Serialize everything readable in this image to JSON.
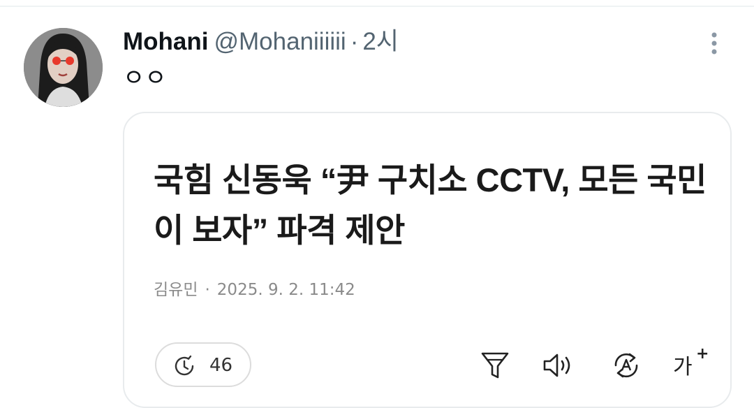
{
  "tweet": {
    "display_name": "Mohani",
    "handle": "@Mohaniiiiii",
    "separator": "·",
    "time": "2시",
    "text": "ㅇㅇ"
  },
  "card": {
    "headline": "국힘 신동욱 “尹 구치소 CCTV, 모든 국민이 보자” 파격 제안",
    "author": "김유민",
    "meta_separator": "·",
    "date": "2025. 9. 2. 11:42",
    "views": "46",
    "font_size_label": "가",
    "font_size_plus": "+"
  },
  "icons": [
    "more-vertical-icon",
    "clock-icon",
    "filter-icon",
    "speaker-icon",
    "translate-icon",
    "font-size-icon"
  ],
  "colors": {
    "secondary_text": "#536471",
    "border": "#e8ebed"
  }
}
